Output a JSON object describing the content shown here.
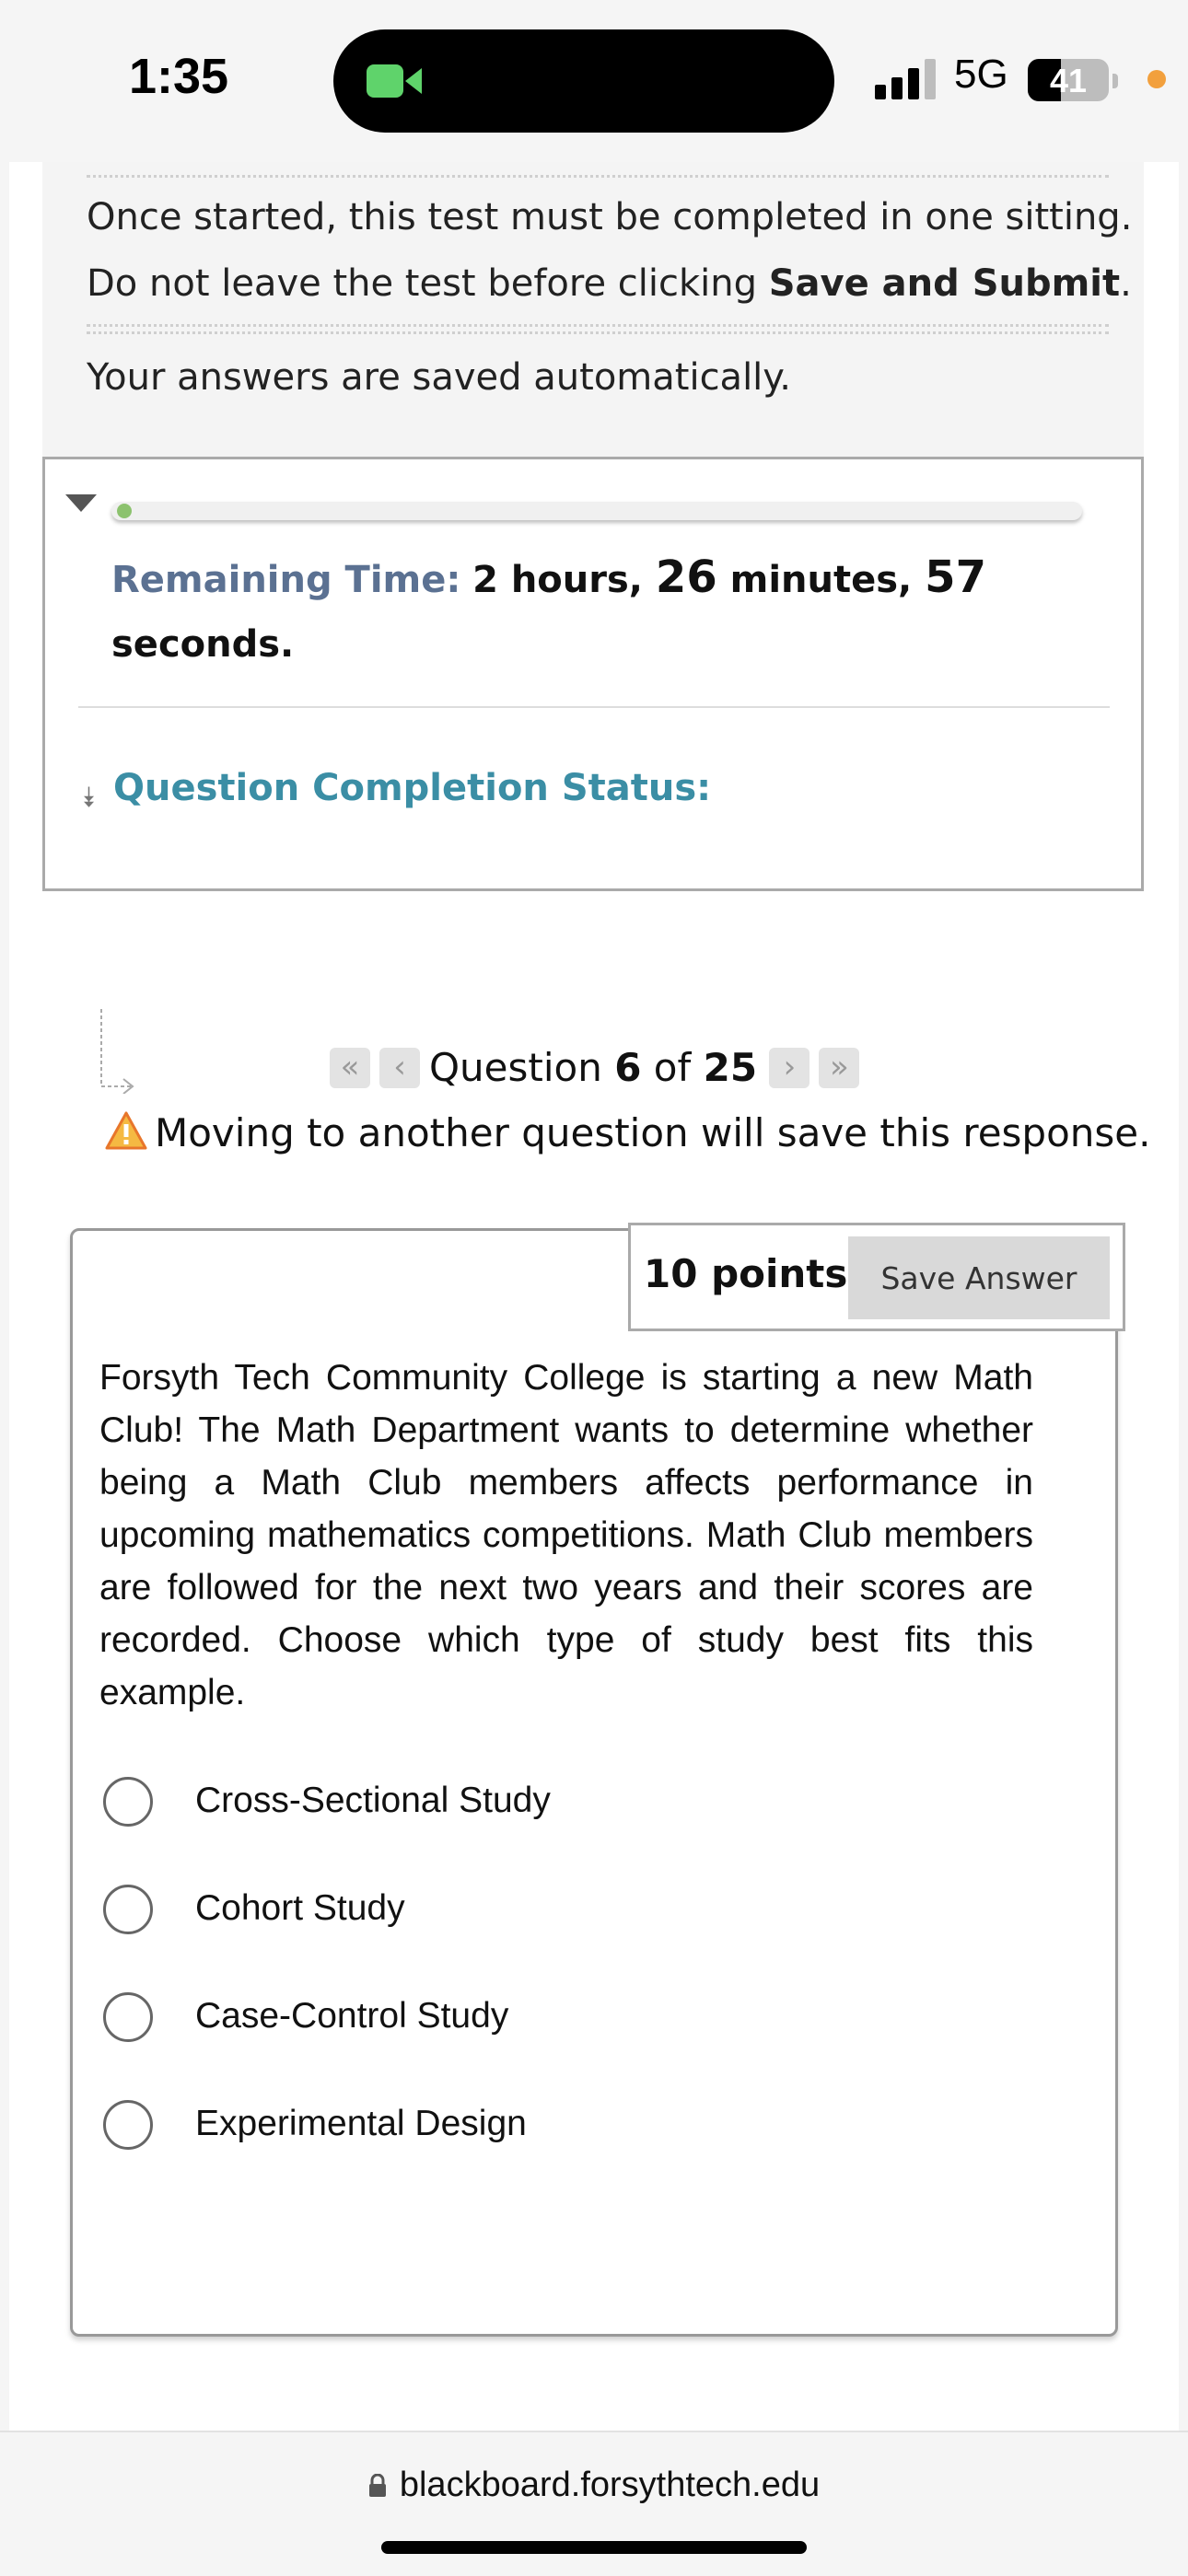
{
  "status_bar": {
    "time": "1:35",
    "network": "5G",
    "battery_level": "41",
    "battery_fraction": 0.41
  },
  "instructions": {
    "line1": "Once started, this test must be completed in one sitting.",
    "line2_prefix": "Do not leave the test before clicking ",
    "line2_bold": "Save and Submit",
    "line2_suffix": ".",
    "line3": "Your answers are saved automatically."
  },
  "timer": {
    "label": "Remaining Time:",
    "hours": "2",
    "hours_word": " hours, ",
    "minutes": "26",
    "minutes_word": " minutes, ",
    "seconds": "57",
    "seconds_word": "seconds."
  },
  "completion_status": {
    "label": "Question Completion Status:"
  },
  "navigation": {
    "question_word": "Question ",
    "current": "6",
    "of_word": " of ",
    "total": "25",
    "warning": "Moving to another question will save this response.",
    "icons": [
      "first-icon",
      "previous-icon",
      "next-icon",
      "last-icon"
    ]
  },
  "question": {
    "points": "10 points",
    "save_label": "Save Answer",
    "text": "Forsyth Tech Community College is starting a new Math Club! The Math Department wants to determine whether being a Math Club members affects performance in upcoming mathematics competitions.  Math Club members are followed for the next two years and their scores are recorded.  Choose which type of study best fits this example.",
    "options": [
      "Cross-Sectional Study",
      "Cohort Study",
      "Case-Control Study",
      "Experimental Design"
    ]
  },
  "browser": {
    "url": "blackboard.forsythtech.edu"
  },
  "colors": {
    "label_blue": "#5b7192",
    "status_teal": "#3b8ea5",
    "progress_green": "#8cc26e",
    "camera_green": "#5fd36b",
    "warning_orange": "#e8762b"
  }
}
